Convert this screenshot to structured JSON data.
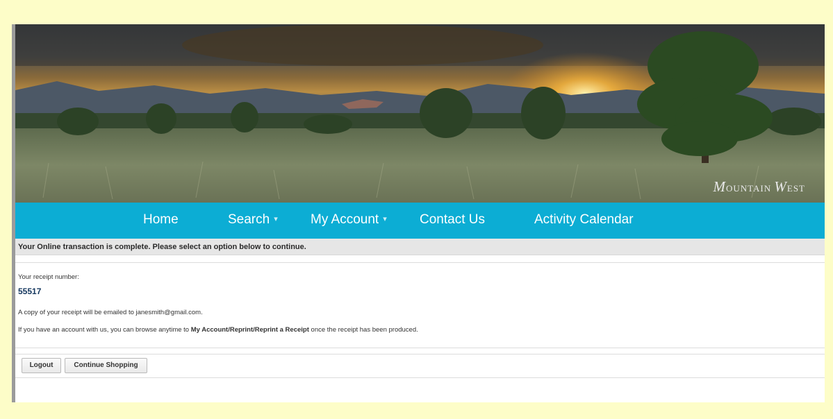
{
  "banner": {
    "brand_initial_1": "M",
    "brand_rest_1": "OUNTAIN",
    "brand_initial_2": "W",
    "brand_rest_2": "EST"
  },
  "nav": {
    "items": [
      {
        "label": "Home",
        "has_dropdown": false
      },
      {
        "label": "Search",
        "has_dropdown": true
      },
      {
        "label": "My Account",
        "has_dropdown": true
      },
      {
        "label": "Contact Us",
        "has_dropdown": false
      },
      {
        "label": "Activity Calendar",
        "has_dropdown": false
      }
    ],
    "caret": "▾"
  },
  "status_message": "Your Online transaction is complete. Please select an option below to continue.",
  "receipt": {
    "label": "Your receipt number:",
    "number": "55517",
    "email_note": "A copy of your receipt will be emailed to janesmith@gmail.com.",
    "browse_prefix": "If you have an account with us, you can browse anytime to ",
    "browse_path": "My Account/Reprint/Reprint a Receipt",
    "browse_suffix": " once the receipt has been produced."
  },
  "buttons": {
    "logout": "Logout",
    "continue_shopping": "Continue Shopping"
  },
  "colors": {
    "page_background": "#fdfdc8",
    "nav_background": "#0cadd4",
    "receipt_number": "#13365e"
  }
}
